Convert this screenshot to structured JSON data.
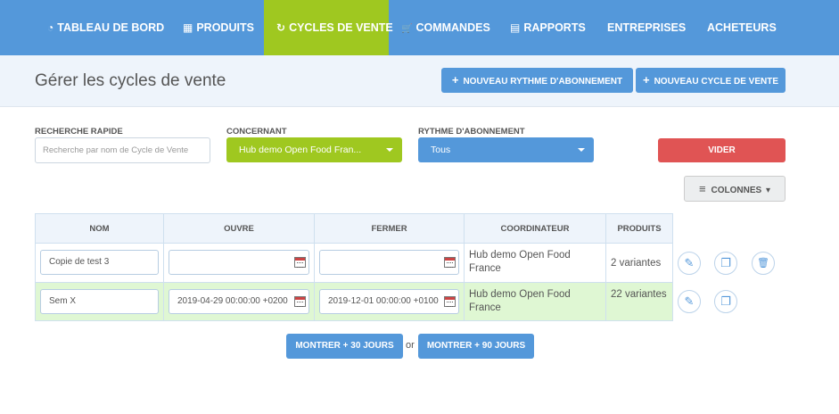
{
  "nav": {
    "items": [
      {
        "label": "TABLEAU DE BORD",
        "icon": "speedometer-icon",
        "glyph": "◔"
      },
      {
        "label": "PRODUITS",
        "icon": "grid-icon",
        "glyph": "▦"
      },
      {
        "label": "CYCLES DE VENTE",
        "icon": "refresh-icon",
        "glyph": "↻"
      },
      {
        "label": "COMMANDES",
        "icon": "cart-icon",
        "glyph": "🛒"
      },
      {
        "label": "RAPPORTS",
        "icon": "file-icon",
        "glyph": "▤"
      },
      {
        "label": "ENTREPRISES",
        "icon": "",
        "glyph": ""
      },
      {
        "label": "ACHETEURS",
        "icon": "",
        "glyph": ""
      }
    ],
    "active": "CYCLES DE VENTE"
  },
  "page": {
    "title": "Gérer les cycles de vente",
    "new_subscription_rhythm": "NOUVEAU RYTHME D'ABONNEMENT",
    "new_sale_cycle": "NOUVEAU CYCLE DE VENTE",
    "plus_glyph": "+"
  },
  "filters": {
    "quick_search_label": "RECHERCHE RAPIDE",
    "quick_search_placeholder": "Recherche par nom de Cycle de Vente",
    "concerning_label": "CONCERNANT",
    "concerning_value": "Hub demo Open Food Fran...",
    "rhythm_label": "RYTHME D'ABONNEMENT",
    "rhythm_value": "Tous",
    "clear_label": "VIDER",
    "columns_label": "COLONNES",
    "columns_icon_glyph": "≡",
    "caret_glyph": "▾"
  },
  "table": {
    "headers": [
      "NOM",
      "OUVRE",
      "FERMER",
      "COORDINATEUR",
      "PRODUITS"
    ],
    "rows": [
      {
        "name": "Copie de test 3",
        "opens": "",
        "closes": "",
        "coordinator": "Hub demo Open Food France",
        "products": "2 variantes"
      },
      {
        "name": "Sem X",
        "opens": "2019-04-29 00:00:00 +0200",
        "closes": "2019-12-01 00:00:00 +0100",
        "coordinator": "Hub demo Open Food France",
        "products": "22 variantes"
      }
    ],
    "action_glyphs": {
      "edit": "✎",
      "clone": "❐",
      "delete": "🗑"
    }
  },
  "footer": {
    "show_30": "MONTRER + 30 JOURS",
    "or": "or",
    "show_90": "MONTRER + 90 JOURS"
  },
  "colors": {
    "nav_blue": "#5498da",
    "active_green": "#9fc820",
    "danger_red": "#e05454",
    "row_highlight": "#dff7d3"
  }
}
